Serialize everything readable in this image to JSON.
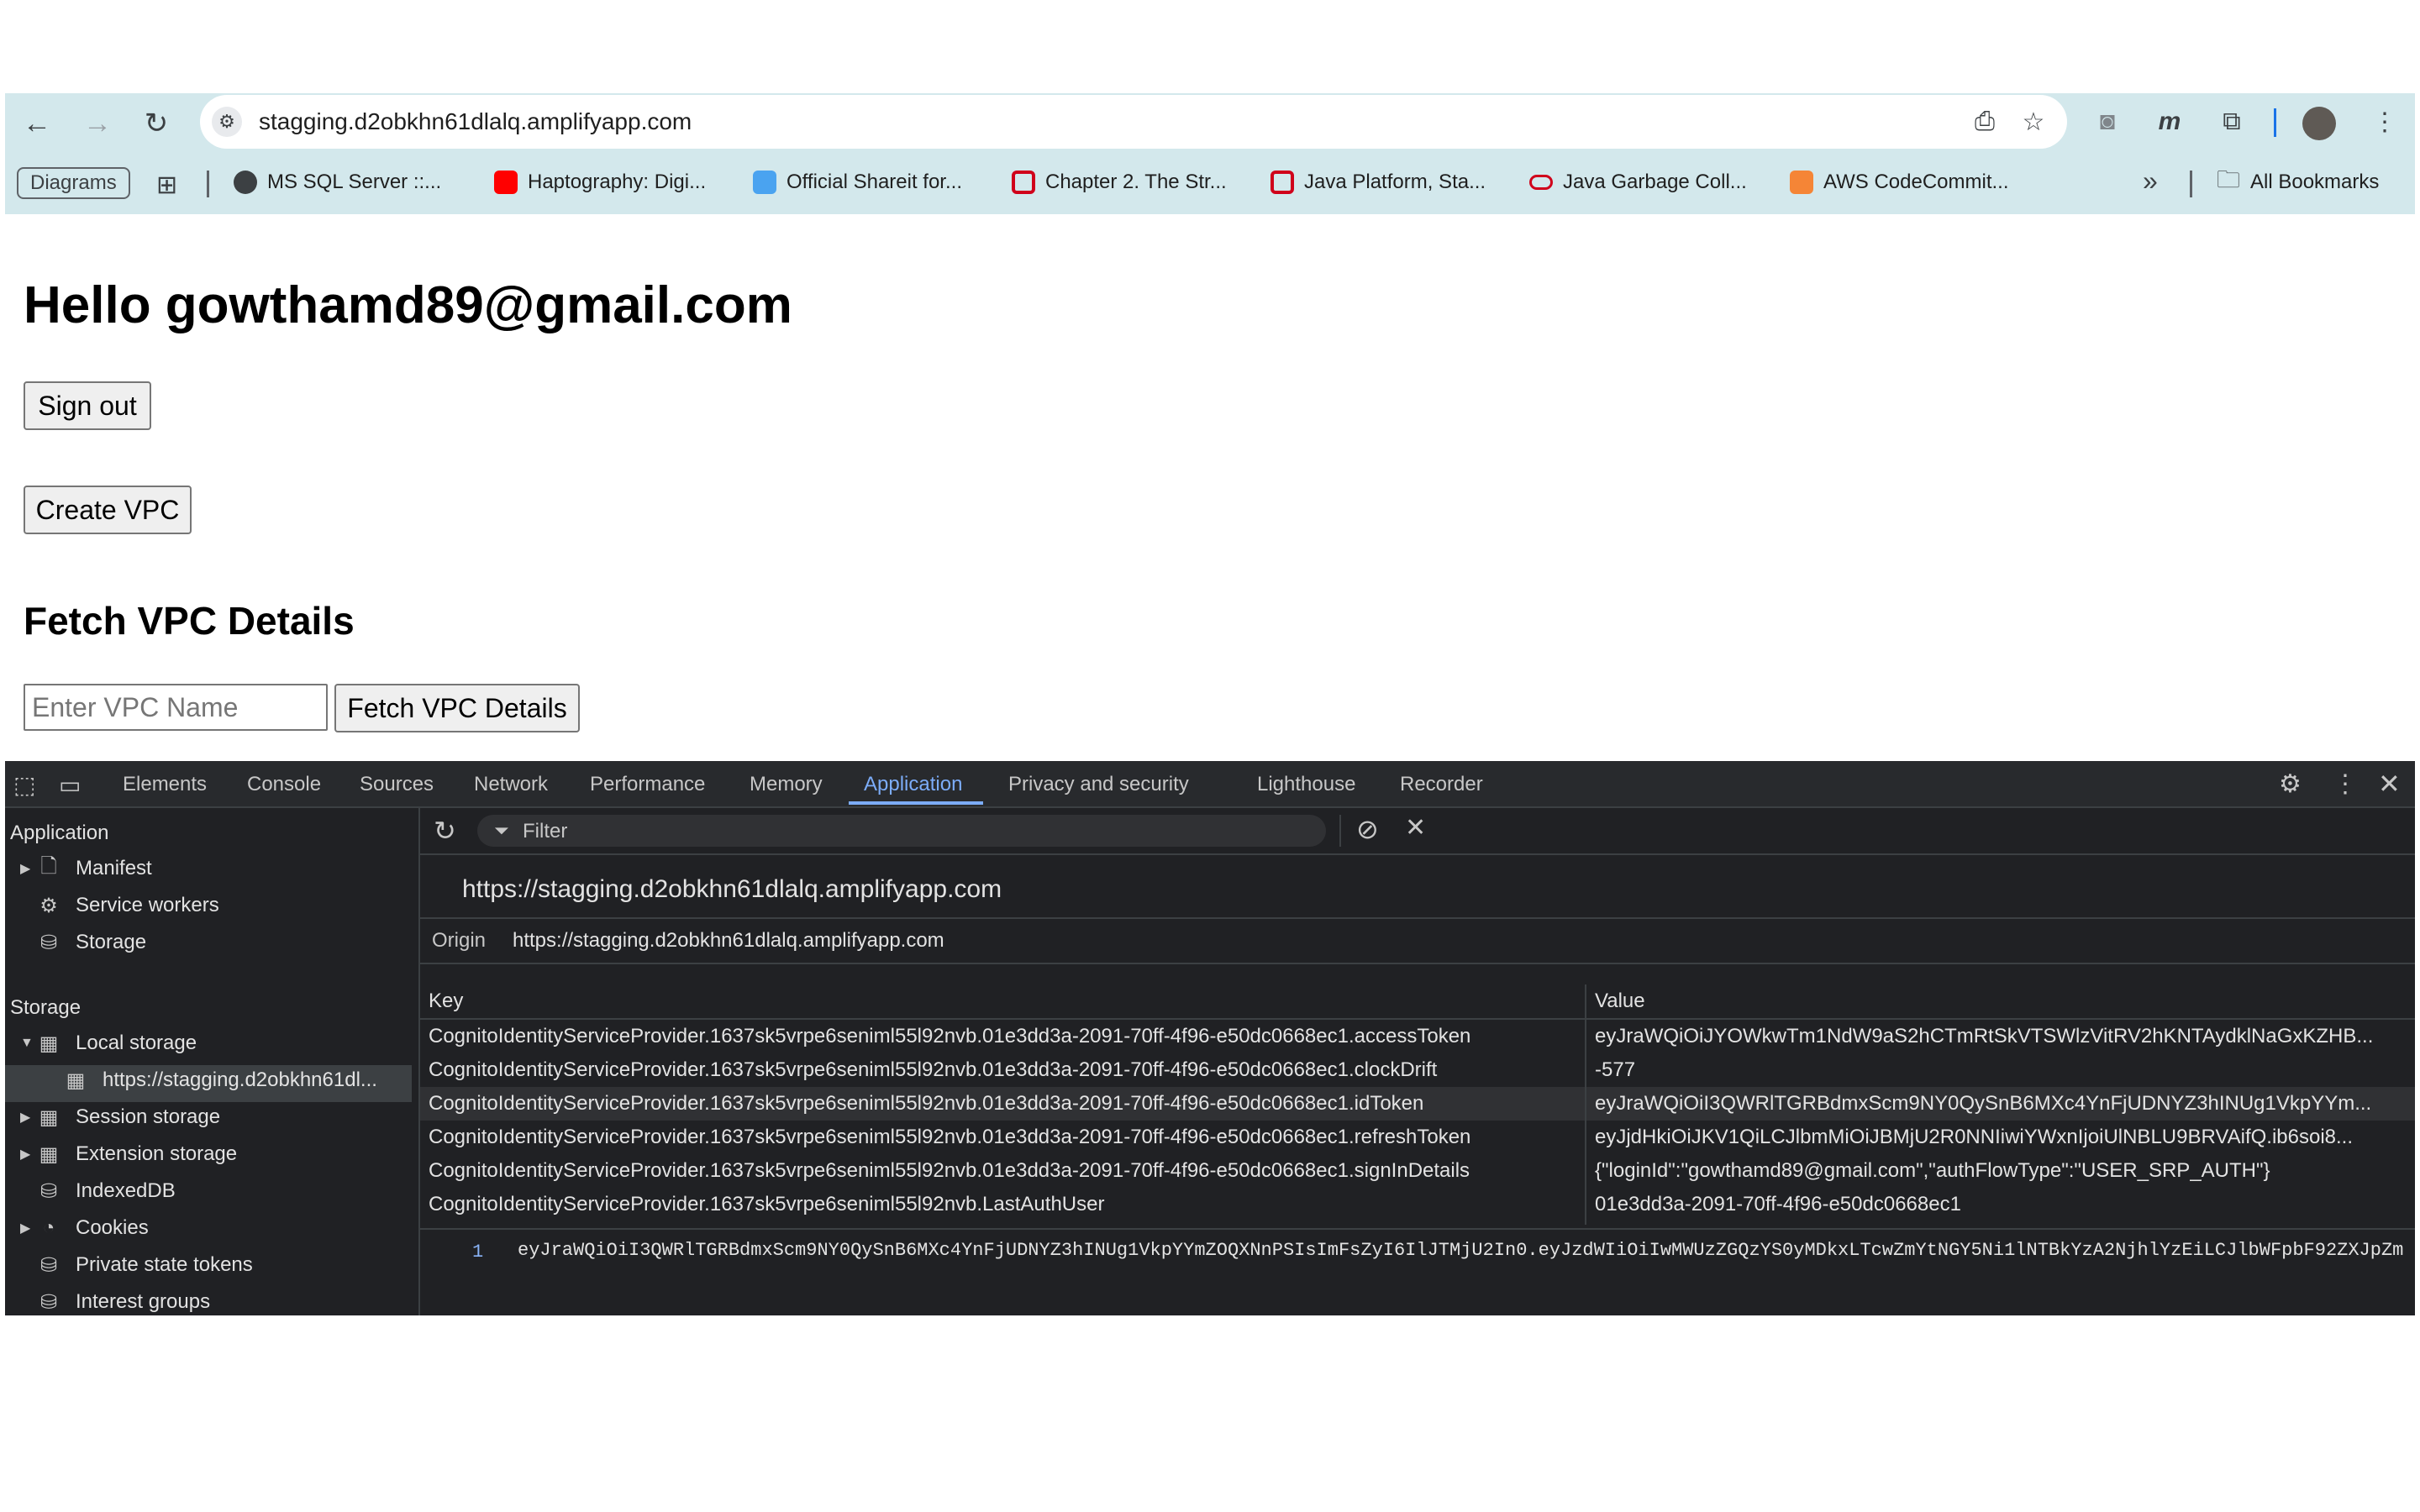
{
  "browser": {
    "url": "stagging.d2obkhn61dlalq.amplifyapp.com",
    "bookmarks": [
      {
        "label": "Diagrams"
      },
      {
        "label": "MS SQL Server ::..."
      },
      {
        "label": "Haptography: Digi..."
      },
      {
        "label": "Official Shareit for..."
      },
      {
        "label": "Chapter 2. The Str..."
      },
      {
        "label": "Java Platform, Sta..."
      },
      {
        "label": "Java Garbage Coll..."
      },
      {
        "label": "AWS CodeCommit..."
      }
    ],
    "all_bookmarks": "All Bookmarks",
    "more": "»"
  },
  "page": {
    "greeting": "Hello gowthamd89@gmail.com",
    "sign_out": "Sign out",
    "create_vpc": "Create VPC",
    "fetch_heading": "Fetch VPC Details",
    "vpc_placeholder": "Enter VPC Name",
    "fetch_button": "Fetch VPC Details"
  },
  "devtools": {
    "tabs": [
      "Elements",
      "Console",
      "Sources",
      "Network",
      "Performance",
      "Memory",
      "Application",
      "Privacy and security",
      "Lighthouse",
      "Recorder"
    ],
    "active_tab": "Application",
    "sidebar": {
      "application_header": "Application",
      "application_items": [
        "Manifest",
        "Service workers",
        "Storage"
      ],
      "storage_header": "Storage",
      "storage_items": [
        "Local storage",
        "https://stagging.d2obkhn61dl...",
        "Session storage",
        "Extension storage",
        "IndexedDB",
        "Cookies",
        "Private state tokens",
        "Interest groups"
      ]
    },
    "filter_placeholder": "Filter",
    "origin_title": "https://stagging.d2obkhn61dlalq.amplifyapp.com",
    "origin_label": "Origin",
    "origin_value": "https://stagging.d2obkhn61dlalq.amplifyapp.com",
    "columns": {
      "key": "Key",
      "value": "Value"
    },
    "rows": [
      {
        "key": "CognitoIdentityServiceProvider.1637sk5vrpe6seniml55l92nvb.01e3dd3a-2091-70ff-4f96-e50dc0668ec1.accessToken",
        "value": "eyJraWQiOiJYOWkwTm1NdW9aS2hCTmRtSkVTSWlzVitRV2hKNTAydklNaGxKZHB..."
      },
      {
        "key": "CognitoIdentityServiceProvider.1637sk5vrpe6seniml55l92nvb.01e3dd3a-2091-70ff-4f96-e50dc0668ec1.clockDrift",
        "value": "-577"
      },
      {
        "key": "CognitoIdentityServiceProvider.1637sk5vrpe6seniml55l92nvb.01e3dd3a-2091-70ff-4f96-e50dc0668ec1.idToken",
        "value": "eyJraWQiOiI3QWRlTGRBdmxScm9NY0QySnB6MXc4YnFjUDNYZ3hINUg1VkpYYm..."
      },
      {
        "key": "CognitoIdentityServiceProvider.1637sk5vrpe6seniml55l92nvb.01e3dd3a-2091-70ff-4f96-e50dc0668ec1.refreshToken",
        "value": "eyJjdHkiOiJKV1QiLCJlbmMiOiJBMjU2R0NNIiwiYWxnIjoiUlNBLU9BRVAifQ.ib6soi8..."
      },
      {
        "key": "CognitoIdentityServiceProvider.1637sk5vrpe6seniml55l92nvb.01e3dd3a-2091-70ff-4f96-e50dc0668ec1.signInDetails",
        "value": "{\"loginId\":\"gowthamd89@gmail.com\",\"authFlowType\":\"USER_SRP_AUTH\"}"
      },
      {
        "key": "CognitoIdentityServiceProvider.1637sk5vrpe6seniml55l92nvb.LastAuthUser",
        "value": "01e3dd3a-2091-70ff-4f96-e50dc0668ec1"
      }
    ],
    "preview_line_number": "1",
    "preview_text": "eyJraWQiOiI3QWRlTGRBdmxScm9NY0QySnB6MXc4YnFjUDNYZ3hINUg1VkpYYmZOQXNnPSIsImFsZyI6IlJTMjU2In0.eyJzdWIiOiIwMWUzZGQzYS0yMDkxLTcwZmYtNGY5Ni1lNTBkYzA2NjhlYzEiLCJlbWFpbF92ZXJpZm"
  }
}
